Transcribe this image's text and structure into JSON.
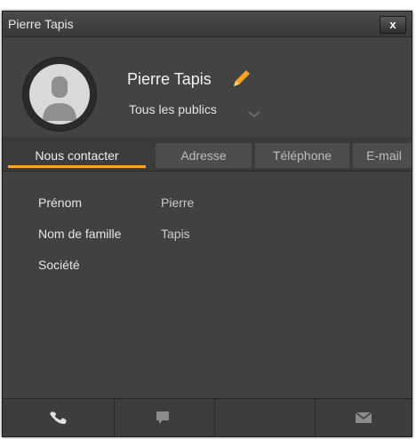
{
  "window": {
    "title": "Pierre Tapis",
    "close_label": "x"
  },
  "contact": {
    "name": "Pierre Tapis",
    "audience": "Tous les publics"
  },
  "tabs": [
    {
      "label": "Nous contacter",
      "active": true
    },
    {
      "label": "Adresse",
      "active": false
    },
    {
      "label": "Téléphone",
      "active": false
    },
    {
      "label": "E-mail",
      "active": false
    }
  ],
  "fields": [
    {
      "label": "Prénom",
      "value": "Pierre"
    },
    {
      "label": "Nom de famille",
      "value": "Tapis"
    },
    {
      "label": "Société",
      "value": ""
    }
  ],
  "footer": {
    "buttons": [
      "phone-icon",
      "chat-icon",
      "blank",
      "mail-icon"
    ]
  },
  "colors": {
    "accent": "#f5a623",
    "background": "#3f3f3f"
  }
}
